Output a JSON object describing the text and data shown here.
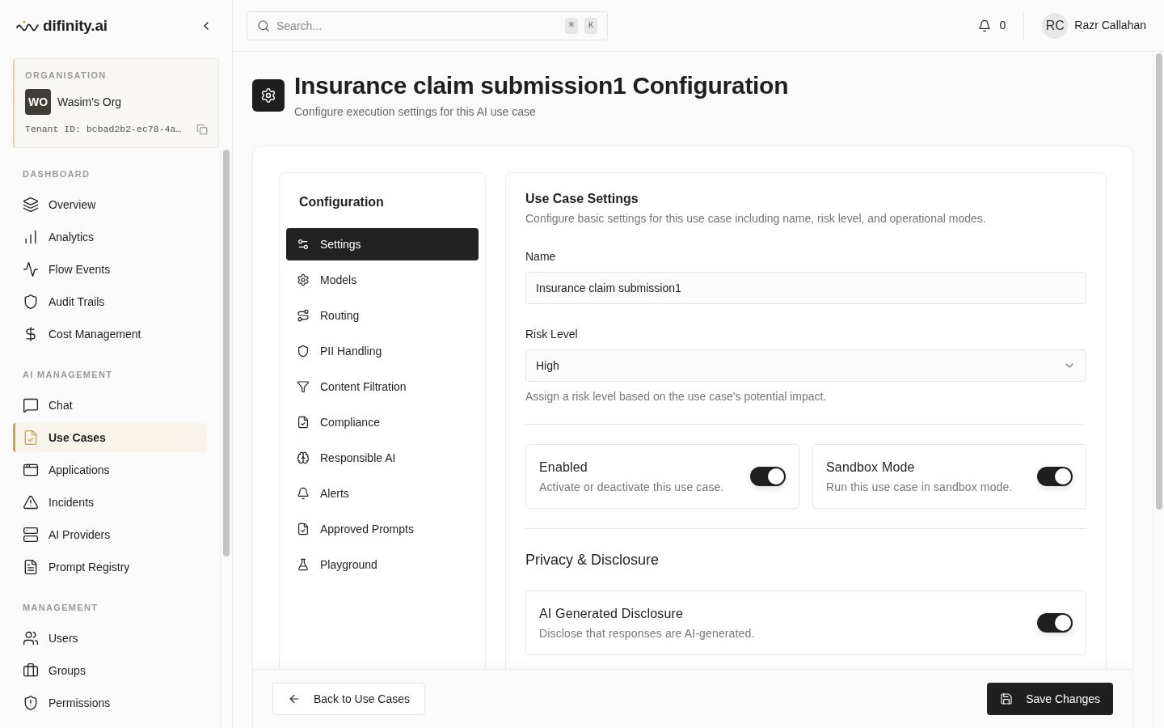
{
  "sidebar": {
    "brand": "difinity.ai",
    "organisation": {
      "label": "ORGANISATION",
      "initials": "WO",
      "name": "Wasim's Org",
      "tenant": "Tenant ID: bcbad2b2-ec78-4a…"
    },
    "sections": [
      {
        "title": "DASHBOARD",
        "items": [
          {
            "label": "Overview",
            "selected": false
          },
          {
            "label": "Analytics",
            "selected": false
          },
          {
            "label": "Flow Events",
            "selected": false
          },
          {
            "label": "Audit Trails",
            "selected": false
          },
          {
            "label": "Cost Management",
            "selected": false
          }
        ]
      },
      {
        "title": "AI MANAGEMENT",
        "items": [
          {
            "label": "Chat",
            "selected": false
          },
          {
            "label": "Use Cases",
            "selected": true
          },
          {
            "label": "Applications",
            "selected": false
          },
          {
            "label": "Incidents",
            "selected": false
          },
          {
            "label": "AI Providers",
            "selected": false
          },
          {
            "label": "Prompt Registry",
            "selected": false
          }
        ]
      },
      {
        "title": "MANAGEMENT",
        "items": [
          {
            "label": "Users",
            "selected": false
          },
          {
            "label": "Groups",
            "selected": false
          },
          {
            "label": "Permissions",
            "selected": false
          }
        ]
      }
    ]
  },
  "topbar": {
    "search": {
      "placeholder": "Search...",
      "keys": [
        "⌘",
        "K"
      ]
    },
    "notifications": "0",
    "user": {
      "initials": "RC",
      "name": "Razr Callahan"
    }
  },
  "page": {
    "title": "Insurance claim submission1 Configuration",
    "subtitle": "Configure execution settings for this AI use case"
  },
  "config_nav": {
    "title": "Configuration",
    "items": [
      {
        "label": "Settings",
        "selected": true
      },
      {
        "label": "Models",
        "selected": false
      },
      {
        "label": "Routing",
        "selected": false
      },
      {
        "label": "PII Handling",
        "selected": false
      },
      {
        "label": "Content Filtration",
        "selected": false
      },
      {
        "label": "Compliance",
        "selected": false
      },
      {
        "label": "Responsible AI",
        "selected": false
      },
      {
        "label": "Alerts",
        "selected": false
      },
      {
        "label": "Approved Prompts",
        "selected": false
      },
      {
        "label": "Playground",
        "selected": false
      }
    ]
  },
  "settings": {
    "title": "Use Case Settings",
    "description": "Configure basic settings for this use case including name, risk level, and operational modes.",
    "fields": [
      {
        "kind": "text",
        "label": "Name",
        "value": "Insurance claim submission1"
      },
      {
        "kind": "select",
        "label": "Risk Level",
        "value": "High",
        "hint": "Assign a risk level based on the use case's potential impact."
      }
    ],
    "toggles": [
      {
        "title": "Enabled",
        "description": "Activate or deactivate this use case.",
        "on": true
      },
      {
        "title": "Sandbox Mode",
        "description": "Run this use case in sandbox mode.",
        "on": true
      }
    ],
    "privacy": {
      "title": "Privacy & Disclosure",
      "toggles": [
        {
          "title": "AI Generated Disclosure",
          "description": "Disclose that responses are AI-generated.",
          "on": true
        }
      ]
    }
  },
  "footer": {
    "back": "Back to Use Cases",
    "save": "Save Changes"
  }
}
